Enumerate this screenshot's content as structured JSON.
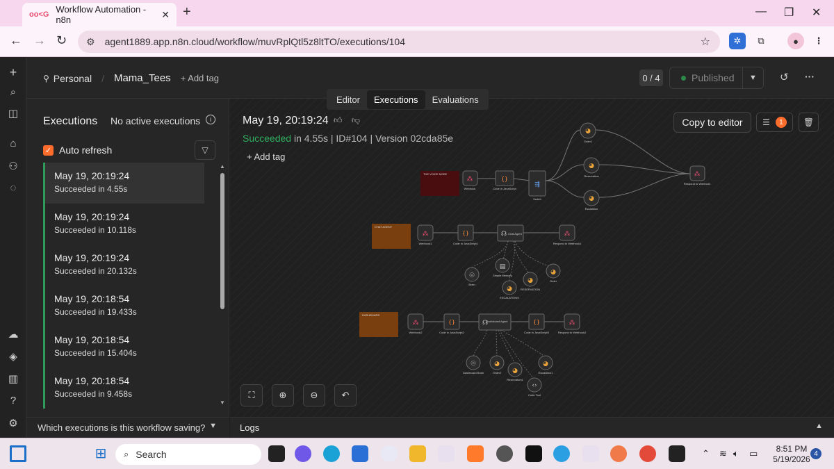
{
  "browser": {
    "tab_title": "Workflow Automation - n8n",
    "tab_favicon": "oo<G",
    "url": "agent1889.app.n8n.cloud/workflow/muvRplQtl5z8ltTO/executions/104"
  },
  "header": {
    "project": "Personal",
    "workflow_name": "Mama_Tees",
    "add_tag": "+ Add tag",
    "tabs": [
      "Editor",
      "Executions",
      "Evaluations"
    ],
    "active_tab": "Executions",
    "counter": "0 / 4",
    "publish_label": "Published"
  },
  "executions_panel": {
    "title": "Executions",
    "active_status": "No active executions",
    "auto_refresh_label": "Auto refresh",
    "items": [
      {
        "date": "May 19, 20:19:24",
        "status": "Succeeded in 4.55s"
      },
      {
        "date": "May 19, 20:19:24",
        "status": "Succeeded in 10.118s"
      },
      {
        "date": "May 19, 20:19:24",
        "status": "Succeeded in 20.132s"
      },
      {
        "date": "May 19, 20:18:54",
        "status": "Succeeded in 19.433s"
      },
      {
        "date": "May 19, 20:18:54",
        "status": "Succeeded in 15.404s"
      },
      {
        "date": "May 19, 20:18:54",
        "status": "Succeeded in 9.458s"
      }
    ],
    "saving_question": "Which executions is this workflow saving?"
  },
  "canvas": {
    "date": "May 19, 20:19:24",
    "status_word": "Succeeded",
    "status_rest": "in 4.55s | ID#104 | Version 02cda85e",
    "add_tag": "+ Add tag",
    "copy_to_editor": "Copy to editor",
    "issues_count": "1",
    "sticky_notes": [
      "THE VOICE NODE",
      "CHAT AGENT",
      "DASHBOARD"
    ],
    "nodes": [
      "Webhook",
      "Code in JavaScript",
      "Switch",
      "Order1",
      "Reservation",
      "Escalation",
      "Respond to Webhook",
      "Webhook1",
      "Code in JavaScript1",
      "Chat Agent",
      "Respond to Webhook1",
      "Brain",
      "Simple Memory",
      "RESERVATION",
      "Order",
      "ESCALATIONS",
      "Webhook2",
      "Code in JavaScript2",
      "Dashboard Agent",
      "Code in JavaScript3",
      "Respond to Webhook2",
      "Dashboard Brain",
      "Order2",
      "Reservation1",
      "Escalation1",
      "Code Tool"
    ]
  },
  "logs": {
    "label": "Logs"
  },
  "taskbar": {
    "search": "Search",
    "time": "8:51 PM",
    "date": "5/19/2026",
    "notifications": "4"
  },
  "colors": {
    "accent": "#ff6d2d",
    "success": "#2fae5e",
    "tab_bar": "#f6d7ee"
  }
}
